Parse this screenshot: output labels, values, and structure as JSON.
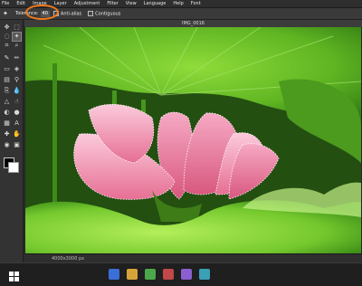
{
  "menu": [
    "File",
    "Edit",
    "Image",
    "Layer",
    "Adjustment",
    "Filter",
    "View",
    "Language",
    "Help",
    "Font"
  ],
  "options": {
    "tolerance_label": "Tolerance:",
    "tolerance_value": "40",
    "antialias_label": "Anti-alias",
    "contiguous_label": "Contiguous"
  },
  "document": {
    "title": "IMG_0016",
    "status": "4000x3000 px"
  },
  "colors": {
    "highlight": "#f07a1e",
    "foreground": "#000000",
    "background": "#ffffff"
  },
  "tools": [
    "move-icon",
    "magic-wand-icon",
    "marquee-icon",
    "lasso-icon",
    "crop-icon",
    "brush-icon",
    "pencil-icon",
    "eraser-icon",
    "fill-icon",
    "gradient-icon",
    "clone-icon",
    "dropper-icon",
    "text-icon",
    "shape-icon",
    "zoom-icon",
    "hand-icon"
  ]
}
